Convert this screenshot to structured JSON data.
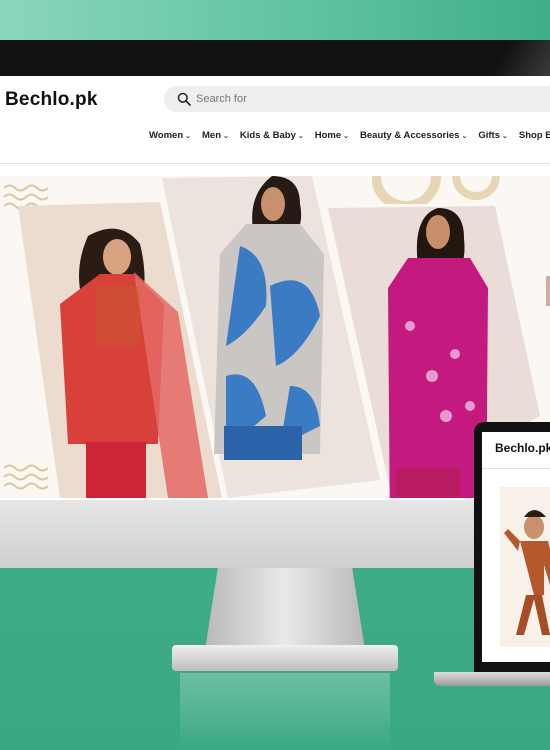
{
  "site": {
    "logo": "Bechlo.pk",
    "search_placeholder": "Search for"
  },
  "nav": {
    "items": [
      {
        "label": "Women"
      },
      {
        "label": "Men"
      },
      {
        "label": "Kids & Baby"
      },
      {
        "label": "Home"
      },
      {
        "label": "Beauty & Accessories"
      },
      {
        "label": "Gifts"
      },
      {
        "label": "Shop By"
      }
    ]
  },
  "hero": {
    "products": [
      {
        "name": "red-embroidered-suit",
        "color": "#d8413a"
      },
      {
        "name": "blue-leaf-print-kurta",
        "color": "#3b7bc4"
      },
      {
        "name": "magenta-embroidered-kurta",
        "color": "#c4197e"
      }
    ]
  },
  "laptop": {
    "logo": "Bechlo.pk"
  },
  "colors": {
    "background": "#44b38e",
    "bezel": "#111111",
    "accent_beige": "#e8d9bd"
  }
}
